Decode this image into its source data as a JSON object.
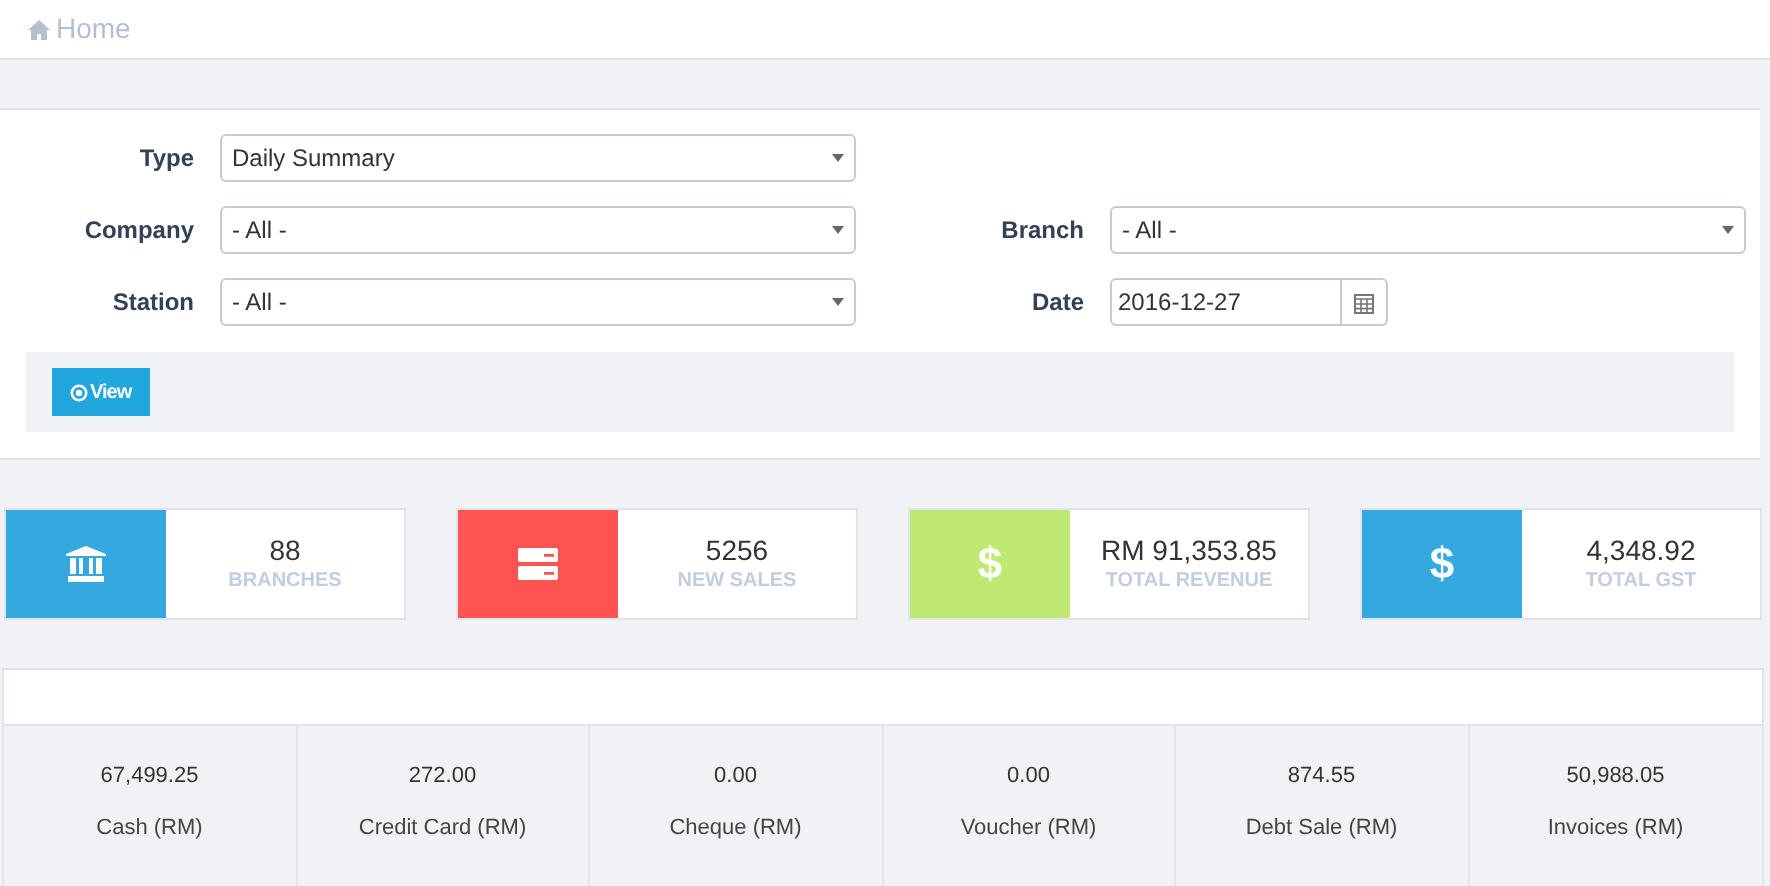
{
  "breadcrumb": {
    "label": "Home"
  },
  "filters": [
    {
      "label": "Type",
      "value": "Daily Summary",
      "kind": "select"
    },
    {
      "label": "Company",
      "value": "- All -",
      "kind": "select"
    },
    {
      "label": "Branch",
      "value": "- All -",
      "kind": "select"
    },
    {
      "label": "Station",
      "value": "- All -",
      "kind": "select"
    },
    {
      "label": "Date",
      "value": "2016-12-27",
      "kind": "date"
    }
  ],
  "view_button": {
    "label": "View"
  },
  "stats": [
    {
      "value": "88",
      "label": "BRANCHES",
      "kind": "bank",
      "color": "#35a8e0"
    },
    {
      "value": "5256",
      "label": "NEW SALES",
      "kind": "server",
      "color": "#ff5252"
    },
    {
      "value": "RM 91,353.85",
      "label": "TOTAL REVENUE",
      "kind": "currency",
      "symbol": "$",
      "color": "#bfe973"
    },
    {
      "value": "4,348.92",
      "label": "TOTAL GST",
      "kind": "currency",
      "symbol": "$",
      "color": "#35a8e0"
    }
  ],
  "payments": [
    {
      "value": "67,499.25",
      "label": "Cash (RM)"
    },
    {
      "value": "272.00",
      "label": "Credit Card (RM)"
    },
    {
      "value": "0.00",
      "label": "Cheque (RM)"
    },
    {
      "value": "0.00",
      "label": "Voucher (RM)"
    },
    {
      "value": "874.55",
      "label": "Debt Sale (RM)"
    },
    {
      "value": "50,988.05",
      "label": "Invoices (RM)"
    }
  ]
}
